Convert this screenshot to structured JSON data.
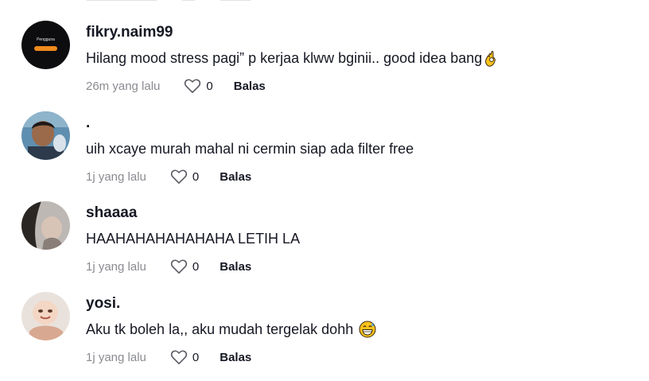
{
  "comments": [
    {
      "username": "fikry.naim99",
      "text": "Hilang mood stress pagi” p kerjaa klww bginii.. good idea bang",
      "time": "26m yang lalu",
      "likes": "0",
      "reply_label": "Balas",
      "avatar_text": "Pengguna",
      "emoji": "ok-hand-emoji"
    },
    {
      "username": ".",
      "text": "uih xcaye murah mahal ni cermin siap ada filter free",
      "time": "1j yang lalu",
      "likes": "0",
      "reply_label": "Balas"
    },
    {
      "username": "shaaaa",
      "text": "HAAHAHAHAHAHAHA LETIH LA",
      "time": "1j yang lalu",
      "likes": "0",
      "reply_label": "Balas"
    },
    {
      "username": "yosi.",
      "text": "Aku tk boleh la,, aku mudah tergelak dohh",
      "time": "1j yang lalu",
      "likes": "0",
      "reply_label": "Balas",
      "emoji": "grinning-sweat-emoji"
    }
  ],
  "colors": {
    "text": "#161823",
    "meta": "#8a8b91",
    "accent_orange": "#f08a1c"
  }
}
